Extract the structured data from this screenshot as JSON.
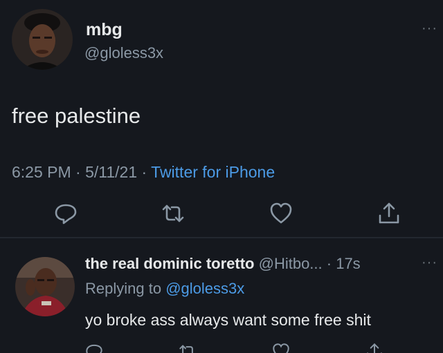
{
  "tweet": {
    "name": "mbg",
    "handle": "@gloless3x",
    "text": "free palestine",
    "time": "6:25 PM",
    "date": "5/11/21",
    "source": "Twitter for iPhone",
    "separator": " · ",
    "more": "···"
  },
  "reply": {
    "name": "the real dominic toretto",
    "handle": "@Hitbo...",
    "time": "· 17s",
    "more": "···",
    "replying_label": "Replying to",
    "replying_to": "@gloless3x",
    "text": "yo broke ass always want some free shit"
  },
  "icons": {
    "reply": "reply-bubble-icon",
    "retweet": "retweet-icon",
    "like": "heart-icon",
    "share": "share-icon"
  },
  "colors": {
    "background": "#15181e",
    "link": "#4c9be6",
    "muted": "#8b98a5",
    "text": "#e7e9ea"
  }
}
